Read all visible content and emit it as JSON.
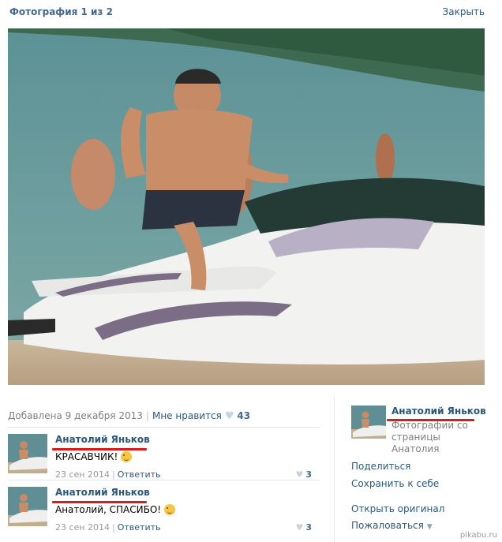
{
  "header": {
    "title": "Фотография 1 из 2",
    "close_label": "Закрыть"
  },
  "photo": {
    "alt": "photo-jet-ski"
  },
  "meta": {
    "added": "Добавлена 9 декабря 2013",
    "separator": "|",
    "likes_label": "Мне нравится",
    "likes_count": "43",
    "heart": "♥"
  },
  "comments": [
    {
      "author": "Анатолий Яньков",
      "text": "КРАСАВЧИК!",
      "date": "23 сен 2014",
      "dot": "|",
      "reply": "Ответить",
      "likes": "3"
    },
    {
      "author": "Анатолий Яньков",
      "text": "Анатолий, СПАСИБО!",
      "date": "23 сен 2014",
      "dot": "|",
      "reply": "Ответить",
      "likes": "3"
    }
  ],
  "sidebar": {
    "owner_name": "Анатолий Яньков",
    "owner_sub": "Фотографии со страницы Анатолия",
    "share": "Поделиться",
    "save": "Сохранить к себе",
    "open_original": "Открыть оригинал",
    "report": "Пожаловаться",
    "chevron": "▼"
  },
  "watermark": "pikabu.ru",
  "colors": {
    "link": "#2b587a",
    "title": "#45688e",
    "underline": "#d91b1b"
  }
}
